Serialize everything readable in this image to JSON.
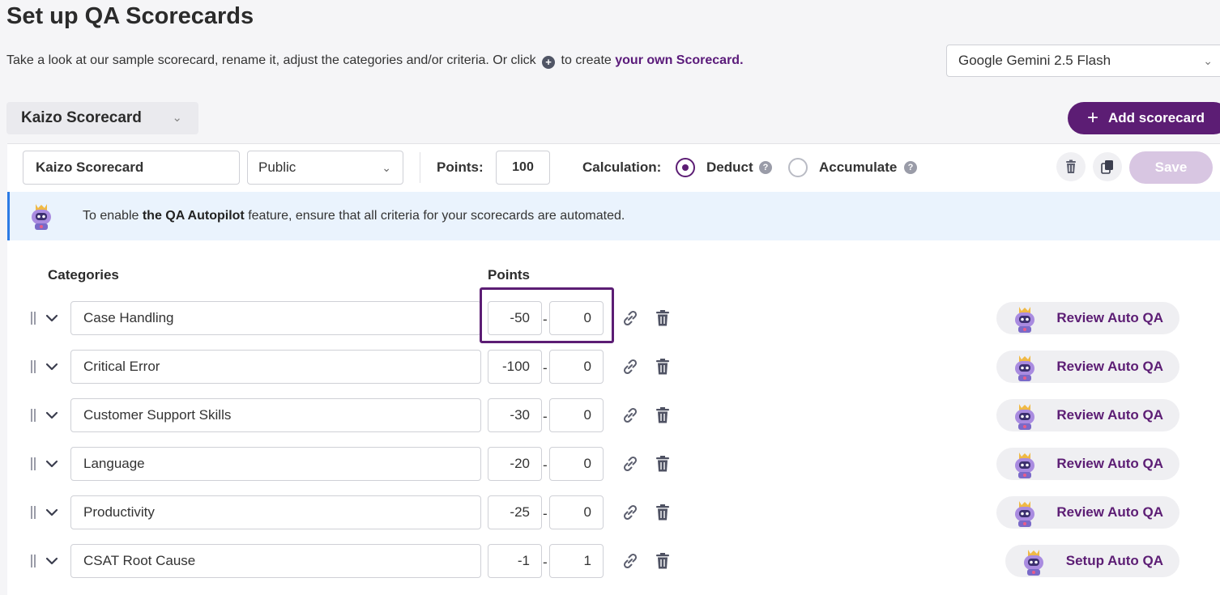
{
  "page": {
    "title": "Set up QA Scorecards",
    "subtitle_before": "Take a look at our sample scorecard, rename it, adjust the categories and/or criteria. Or click",
    "subtitle_plus": "+",
    "subtitle_middle": "to create",
    "subtitle_link": "your own Scorecard."
  },
  "model_select": {
    "value": "Google Gemini 2.5 Flash"
  },
  "scorecard_tab": {
    "label": "Kaizo Scorecard"
  },
  "add_scorecard": {
    "plus": "+",
    "label": "Add scorecard"
  },
  "settings": {
    "name_value": "Kaizo Scorecard",
    "visibility_value": "Public",
    "points_label": "Points:",
    "points_value": "100",
    "calculation_label": "Calculation:",
    "deduct_label": "Deduct",
    "accumulate_label": "Accumulate",
    "help_glyph": "?",
    "save_label": "Save",
    "selected_calculation": "Deduct"
  },
  "banner": {
    "text_before": "To enable",
    "text_bold": "the QA Autopilot",
    "text_after": "feature, ensure that all criteria for your scorecards are automated."
  },
  "table": {
    "categories_header": "Categories",
    "points_header": "Points",
    "dash": "-",
    "rows": [
      {
        "name": "Case Handling",
        "min": "-50",
        "max": "0",
        "action": "Review Auto QA"
      },
      {
        "name": "Critical Error",
        "min": "-100",
        "max": "0",
        "action": "Review Auto QA"
      },
      {
        "name": "Customer Support Skills",
        "min": "-30",
        "max": "0",
        "action": "Review Auto QA"
      },
      {
        "name": "Language",
        "min": "-20",
        "max": "0",
        "action": "Review Auto QA"
      },
      {
        "name": "Productivity",
        "min": "-25",
        "max": "0",
        "action": "Review Auto QA"
      },
      {
        "name": "CSAT Root Cause",
        "min": "-1",
        "max": "1",
        "action": "Setup Auto QA"
      }
    ]
  },
  "colors": {
    "brand": "#5c1d74",
    "banner_bg": "#eaf3fd",
    "banner_accent": "#2c7be5"
  },
  "icons": [
    "chevron-down-icon",
    "plus-icon",
    "help-icon",
    "trash-icon",
    "copy-icon",
    "robot-icon",
    "drag-handle-icon",
    "link-icon"
  ]
}
